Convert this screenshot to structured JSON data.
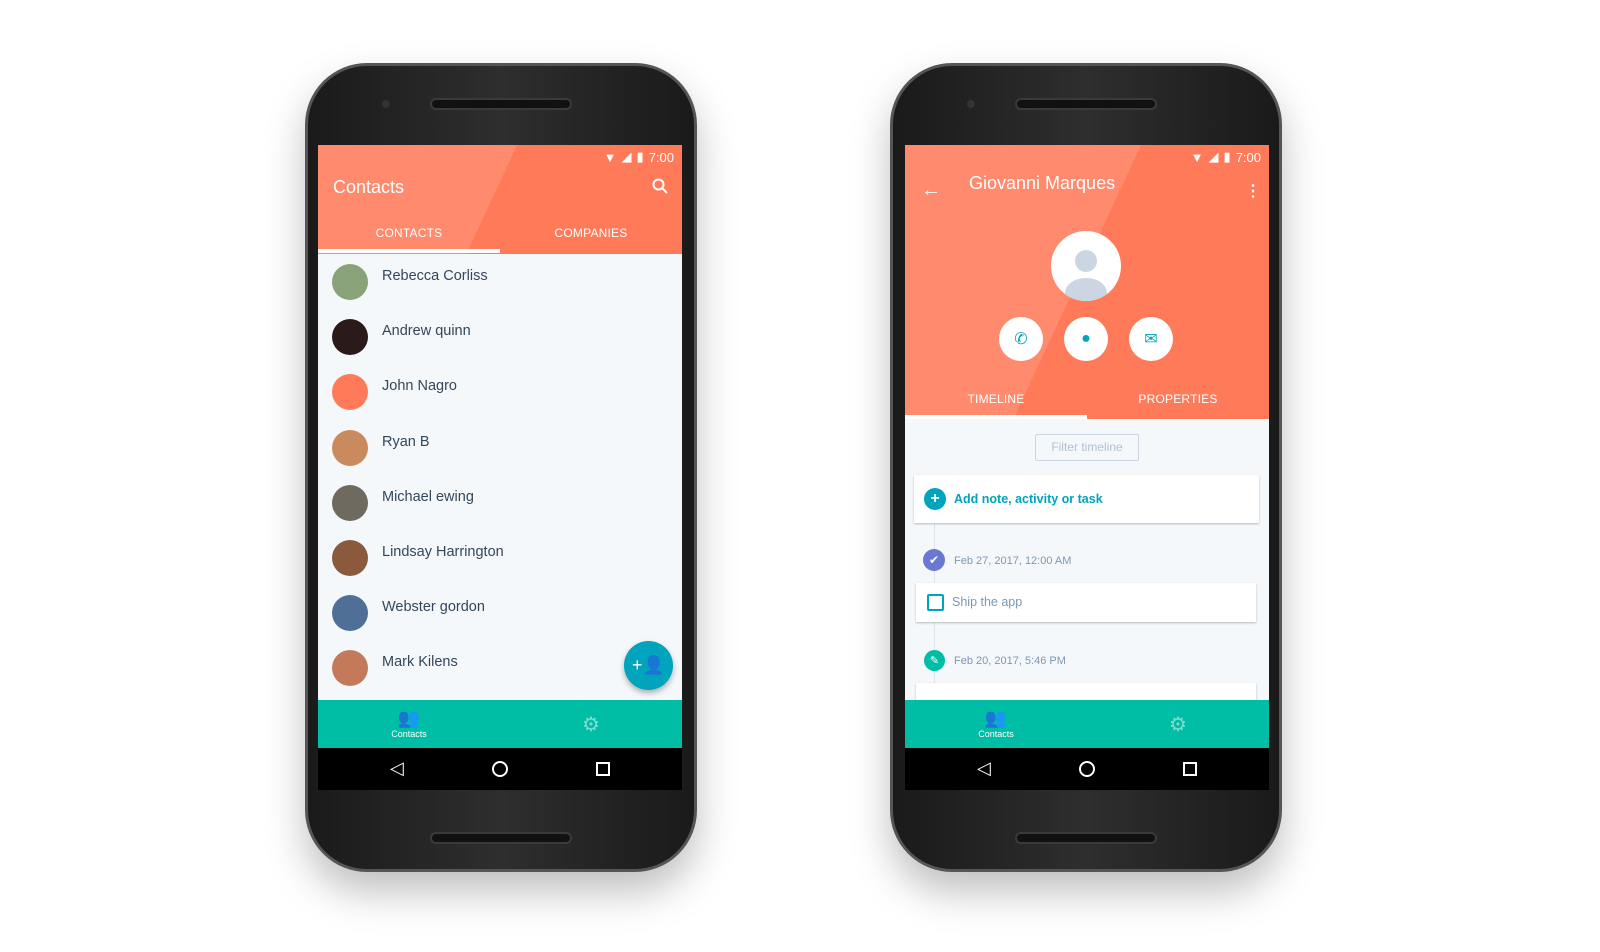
{
  "left": {
    "status": {
      "time": "7:00"
    },
    "title": "Contacts",
    "tabs": [
      "CONTACTS",
      "COMPANIES"
    ],
    "contacts": [
      {
        "name": "Rebecca Corliss",
        "color": "#8aa27a"
      },
      {
        "name": "Andrew quinn",
        "color": "#2b1a1a"
      },
      {
        "name": "John Nagro",
        "color": "#ff7a59"
      },
      {
        "name": "Ryan B",
        "color": "#c98a5e"
      },
      {
        "name": "Michael ewing",
        "color": "#6f6a5f"
      },
      {
        "name": "Lindsay Harrington",
        "color": "#8b5a3c"
      },
      {
        "name": "Webster gordon",
        "color": "#4f6f96"
      },
      {
        "name": "Mark Kilens",
        "color": "#c47a5a"
      }
    ],
    "bottom_nav": {
      "contacts_label": "Contacts"
    }
  },
  "right": {
    "status": {
      "time": "7:00"
    },
    "title": "Giovanni Marques",
    "tabs": [
      "TIMELINE",
      "PROPERTIES"
    ],
    "filter_label": "Filter timeline",
    "add_label": "Add note, activity or task",
    "timeline": [
      {
        "date": "Feb 27, 2017, 12:00 AM",
        "task": "Ship the app"
      },
      {
        "date": "Feb 20, 2017, 5:46 PM"
      }
    ],
    "bottom_nav": {
      "contacts_label": "Contacts"
    }
  },
  "colors": {
    "orange": "#ff7a59",
    "teal": "#00bda5",
    "accent": "#00a4bd",
    "purple": "#6a78d1"
  }
}
